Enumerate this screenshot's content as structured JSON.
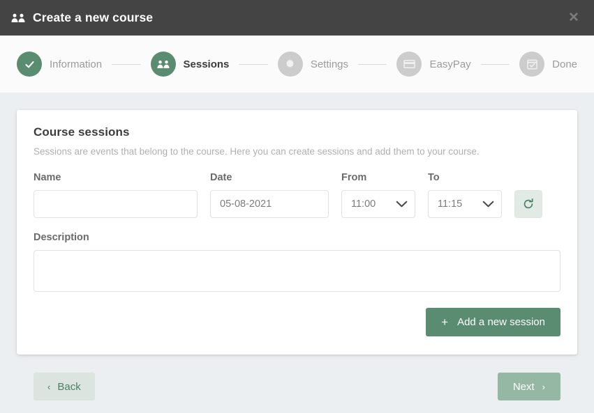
{
  "modal": {
    "title": "Create a new course",
    "title_icon": "people-group-icon",
    "close_label": "✕"
  },
  "stepper": {
    "steps": [
      {
        "label": "Information",
        "icon": "check-icon",
        "state": "done"
      },
      {
        "label": "Sessions",
        "icon": "people-group-icon",
        "state": "active"
      },
      {
        "label": "Settings",
        "icon": "gear-icon",
        "state": "todo"
      },
      {
        "label": "EasyPay",
        "icon": "credit-card-icon",
        "state": "todo"
      },
      {
        "label": "Done",
        "icon": "calendar-check-icon",
        "state": "todo"
      }
    ]
  },
  "card": {
    "title": "Course sessions",
    "subtitle": "Sessions are events that belong to the course. Here you can create sessions and add them to your course.",
    "fields": {
      "name": {
        "label": "Name",
        "value": "",
        "placeholder": ""
      },
      "date": {
        "label": "Date",
        "value": "05-08-2021",
        "placeholder": ""
      },
      "from": {
        "label": "From",
        "value": "11:00"
      },
      "to": {
        "label": "To",
        "value": "11:15"
      },
      "description": {
        "label": "Description",
        "value": "",
        "placeholder": ""
      }
    },
    "refresh_button": {
      "icon": "refresh-icon",
      "label": ""
    },
    "add_button": {
      "label": "Add a new session",
      "icon": "plus-icon"
    }
  },
  "footer": {
    "back": {
      "label": "Back",
      "icon": "chevron-left-icon"
    },
    "next": {
      "label": "Next",
      "icon": "chevron-right-icon"
    }
  },
  "colors": {
    "accent_green": "#5a8c71",
    "accent_green_light": "#94b8a3",
    "header_dark": "#444444",
    "page_bg": "#eceff1",
    "step_todo": "#cccccc"
  }
}
